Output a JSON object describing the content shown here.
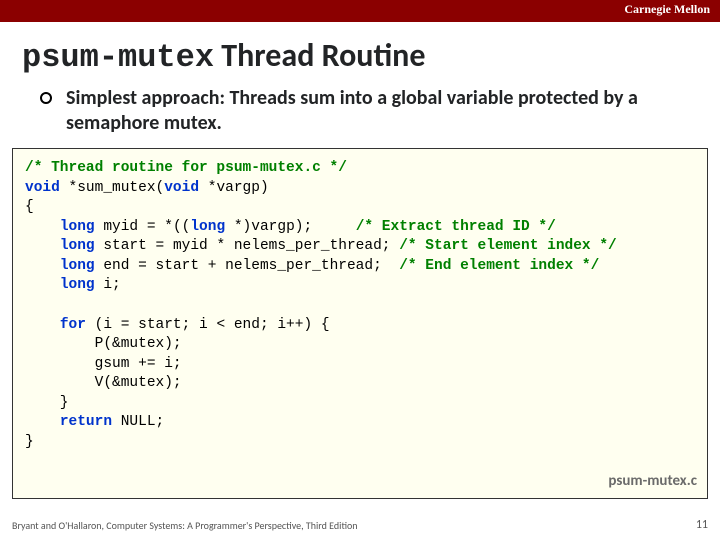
{
  "brand": "Carnegie Mellon",
  "title_code": "psum-mutex",
  "title_rest": " Thread Routine",
  "bullet": "Simplest approach: Threads sum into a global variable protected by a semaphore mutex.",
  "code": {
    "c1": "/* Thread routine for psum-mutex.c */",
    "kw_void1": "void",
    "fn": " *sum_mutex(",
    "kw_void2": "void",
    "arg": " *vargp)",
    "lbrace": "{",
    "kw_long1": "long",
    "l1": " myid = *((",
    "kw_long1b": "long",
    "l1b": " *)vargp);     ",
    "c_l1": "/* Extract thread ID */",
    "kw_long2": "long",
    "l2": " start = myid * nelems_per_thread; ",
    "c_l2": "/* Start element index */",
    "kw_long3": "long",
    "l3": " end = start + nelems_per_thread;  ",
    "c_l3": "/* End element index */",
    "kw_long4": "long",
    "l4": " i;",
    "blank": "",
    "kw_for": "for",
    "forhead": " (i = start; i < end; i++) {",
    "body1": "        P(&mutex);",
    "body2": "        gsum += i;",
    "body3": "        V(&mutex);",
    "forclose": "    }",
    "kw_return": "return",
    "retval": " NULL;",
    "rbrace": "}"
  },
  "filelabel": "psum-mutex.c",
  "footer_attrib": "Bryant and O'Hallaron, Computer Systems: A Programmer's Perspective, Third Edition",
  "footer_page": "11"
}
